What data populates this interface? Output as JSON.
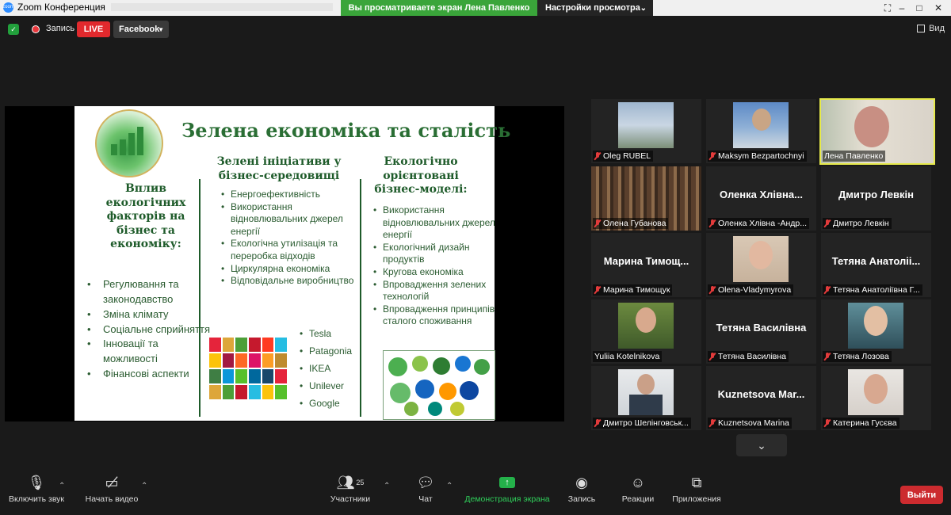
{
  "window": {
    "title": "Zoom Конференция"
  },
  "banner": {
    "viewing_text": "Вы просматриваете экран Лена Павленко",
    "view_options": "Настройки просмотра"
  },
  "topbar": {
    "record_label": "Запись",
    "live_label": "LIVE",
    "stream_label": "Facebook",
    "view_label": "Вид"
  },
  "slide": {
    "title": "Зелена економіка та сталість",
    "col1_heading": "Вплив екологічних факторів на бізнес та економіку:",
    "col1_items": [
      "Регулювання та законодавство",
      "Зміна клімату",
      "Соціальне сприйняття",
      "Інновації та можливості",
      "Фінансові аспекти"
    ],
    "col2_heading": "Зелені ініціативи у бізнес-середовищі",
    "col2_items": [
      "Енергоефективність",
      "Використання відновлювальних джерел енергії",
      "Екологічна утилізація та переробка відходів",
      "Циркулярна економіка",
      "Відповідальне виробництво"
    ],
    "brands": [
      "Tesla",
      "Patagonia",
      "IKEA",
      "Unilever",
      "Google"
    ],
    "col3_heading": "Екологічно орієнтовані бізнес-моделі:",
    "col3_items": [
      "Використання відновлювальних джерел енергії",
      "Екологічний дизайн продуктів",
      "Кругова економіка",
      "Впровадження зелених технологій",
      "Впровадження принципів сталого споживання"
    ]
  },
  "participants": [
    {
      "label": "Oleg RUBEL",
      "big_name": ""
    },
    {
      "label": "Maksym Bezpartochnyi",
      "big_name": ""
    },
    {
      "label": "Лена Павленко",
      "big_name": ""
    },
    {
      "label": "Олена Губанова",
      "big_name": ""
    },
    {
      "label": "Оленка Хлівна -Андр...",
      "big_name": "Оленка Хлівна..."
    },
    {
      "label": "Дмитро Левкін",
      "big_name": "Дмитро Левкін"
    },
    {
      "label": "Марина Тимощук",
      "big_name": "Марина Тимощ..."
    },
    {
      "label": "Olena-Vladymyrova",
      "big_name": ""
    },
    {
      "label": "Тетяна Анатоліївна Г...",
      "big_name": "Тетяна Анатоліі..."
    },
    {
      "label": "Yuliia Kotelnikova",
      "big_name": ""
    },
    {
      "label": "Тетяна Василівна",
      "big_name": "Тетяна Василівна"
    },
    {
      "label": "Тетяна Лозова",
      "big_name": ""
    },
    {
      "label": "Дмитро Шелінговськ...",
      "big_name": ""
    },
    {
      "label": "Kuznetsova Marina",
      "big_name": "Kuznetsova Mar..."
    },
    {
      "label": "Катерина Гусєва",
      "big_name": ""
    }
  ],
  "toolbar": {
    "mute": "Включить звук",
    "video": "Начать видео",
    "participants_count": "25",
    "participants": "Участники",
    "chat": "Чат",
    "share": "Демонстрация экрана",
    "record": "Запись",
    "reactions": "Реакции",
    "apps": "Приложения",
    "leave": "Выйти"
  },
  "colors": {
    "accent_green": "#24b14a",
    "live_red": "#e1292d",
    "leave_red": "#cc2b2f",
    "active_speaker": "#e6e94b",
    "slide_text": "#1e5b2a"
  }
}
